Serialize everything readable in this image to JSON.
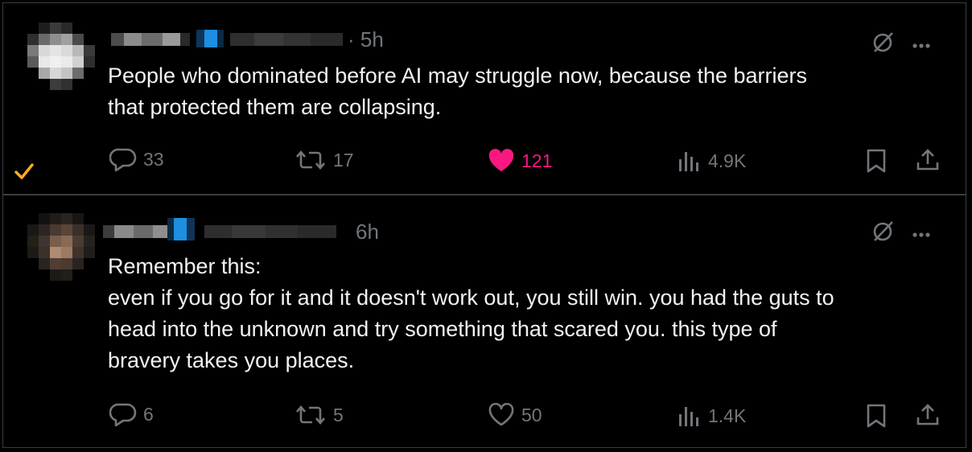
{
  "tweets": [
    {
      "time": "· 5h",
      "text": "People who dominated before AI may struggle now, because the barriers\nthat protected them are collapsing.",
      "replies": "33",
      "reposts": "17",
      "likes": "121",
      "liked": true,
      "views": "4.9K",
      "icons": [
        "grok-icon",
        "more-icon",
        "reply-icon",
        "repost-icon",
        "like-icon",
        "views-icon",
        "bookmark-icon",
        "share-icon"
      ]
    },
    {
      "time": "6h",
      "text": "Remember this:\neven if you go for it and it doesn't work out, you still win. you had the guts to\nhead into the unknown and try something that scared you. this type of\nbravery takes you places.",
      "replies": "6",
      "reposts": "5",
      "likes": "50",
      "liked": false,
      "views": "1.4K",
      "icons": [
        "grok-icon",
        "more-icon",
        "reply-icon",
        "repost-icon",
        "like-icon",
        "views-icon",
        "bookmark-icon",
        "share-icon"
      ]
    }
  ],
  "colors": {
    "background": "#000000",
    "text": "#e7e9ea",
    "muted": "#71767b",
    "like": "#f91880",
    "check": "#ffad1f",
    "verified": "#1d9bf0"
  }
}
